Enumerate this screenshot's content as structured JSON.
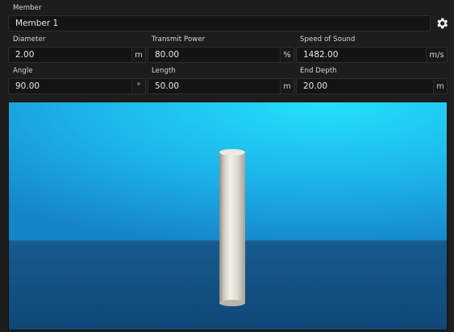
{
  "member": {
    "label": "Member",
    "value": "Member 1"
  },
  "settings": {
    "icon": "gear-icon"
  },
  "fields": {
    "diameter": {
      "label": "Diameter",
      "value": "2.00",
      "unit": "m"
    },
    "transmit_power": {
      "label": "Transmit Power",
      "value": "80.00",
      "unit": "%"
    },
    "speed_of_sound": {
      "label": "Speed of Sound",
      "value": "1482.00",
      "unit": "m/s"
    },
    "angle": {
      "label": "Angle",
      "value": "90.00",
      "unit": "°"
    },
    "length": {
      "label": "Length",
      "value": "50.00",
      "unit": "m"
    },
    "end_depth": {
      "label": "End Depth",
      "value": "20.00",
      "unit": "m"
    }
  },
  "colors": {
    "sky_top": "#1fd3f5",
    "sky_bottom": "#1a8fd0",
    "floor": "#134f80",
    "pillar": "#e6e3da"
  }
}
